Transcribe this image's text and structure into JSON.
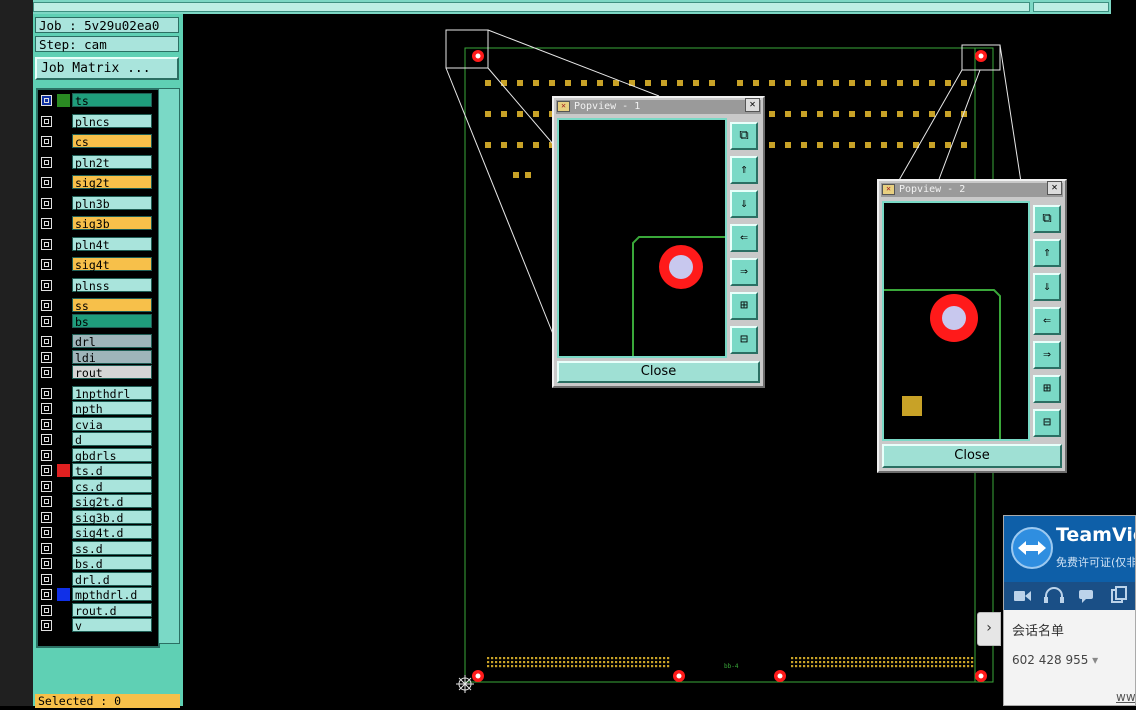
{
  "job_label": "Job : 5v29u02ea0",
  "step_label": "Step: cam",
  "job_matrix_button": "Job Matrix ...",
  "selected_label": "Selected : 0",
  "layers": [
    {
      "name": "ts",
      "color": "#1f9d7c",
      "swatch": "#2a8a22"
    },
    {
      "name": "plncs",
      "color": "#a9e4dc",
      "swatch": ""
    },
    {
      "name": "cs",
      "color": "#f7c04a",
      "swatch": ""
    },
    {
      "name": "pln2t",
      "color": "#a9e4dc",
      "swatch": ""
    },
    {
      "name": "sig2t",
      "color": "#f7c04a",
      "swatch": ""
    },
    {
      "name": "pln3b",
      "color": "#a9e4dc",
      "swatch": ""
    },
    {
      "name": "sig3b",
      "color": "#f7c04a",
      "swatch": ""
    },
    {
      "name": "pln4t",
      "color": "#a9e4dc",
      "swatch": ""
    },
    {
      "name": "sig4t",
      "color": "#f7c04a",
      "swatch": ""
    },
    {
      "name": "plnss",
      "color": "#a9e4dc",
      "swatch": ""
    },
    {
      "name": "ss",
      "color": "#f7c04a",
      "swatch": ""
    },
    {
      "name": "bs",
      "color": "#1f9d7c",
      "swatch": ""
    },
    {
      "name": "drl",
      "color": "#9fb5ba",
      "swatch": ""
    },
    {
      "name": "ldi",
      "color": "#9fb5ba",
      "swatch": ""
    },
    {
      "name": "rout",
      "color": "#d5d5d5",
      "swatch": ""
    },
    {
      "name": "1npthdrl",
      "color": "#a9e4dc",
      "swatch": ""
    },
    {
      "name": "npth",
      "color": "#a9e4dc",
      "swatch": ""
    },
    {
      "name": "cvia",
      "color": "#a9e4dc",
      "swatch": ""
    },
    {
      "name": "d",
      "color": "#a9e4dc",
      "swatch": ""
    },
    {
      "name": "gbdrls",
      "color": "#a9e4dc",
      "swatch": ""
    },
    {
      "name": "ts.d",
      "color": "#a9e4dc",
      "swatch": "#e02020"
    },
    {
      "name": "cs.d",
      "color": "#a9e4dc",
      "swatch": ""
    },
    {
      "name": "sig2t.d",
      "color": "#a9e4dc",
      "swatch": ""
    },
    {
      "name": "sig3b.d",
      "color": "#a9e4dc",
      "swatch": ""
    },
    {
      "name": "sig4t.d",
      "color": "#a9e4dc",
      "swatch": ""
    },
    {
      "name": "ss.d",
      "color": "#a9e4dc",
      "swatch": ""
    },
    {
      "name": "bs.d",
      "color": "#a9e4dc",
      "swatch": ""
    },
    {
      "name": "drl.d",
      "color": "#a9e4dc",
      "swatch": ""
    },
    {
      "name": "mpthdrl.d",
      "color": "#a9e4dc",
      "swatch": "#1030e8"
    },
    {
      "name": "rout.d",
      "color": "#a9e4dc",
      "swatch": ""
    },
    {
      "name": "v",
      "color": "#a9e4dc",
      "swatch": ""
    }
  ],
  "popview1": {
    "title": "Popview - 1",
    "close_label": "Close"
  },
  "popview2": {
    "title": "Popview - 2",
    "close_label": "Close"
  },
  "board_label": "bb-4",
  "teamviewer": {
    "title": "TeamVie",
    "subtitle": "免费许可证(仅非",
    "session_list": "会话名单",
    "partner_id": "602 428 955",
    "dropdown_glyph": "▾",
    "www": "www",
    "collapse_glyph": "›"
  },
  "toolbar_icons": [
    "zoom-fit-icon",
    "pan-up-icon",
    "pan-down-icon",
    "pan-left-icon",
    "pan-right-icon",
    "zoom-in-icon",
    "zoom-out-icon"
  ],
  "colors": {
    "panel": "#5fd0b4",
    "pad_ring": "#ff1a1a",
    "pad_hole": "#c8c8ee",
    "smd": "#c8a227",
    "outline": "#3aa83a"
  }
}
